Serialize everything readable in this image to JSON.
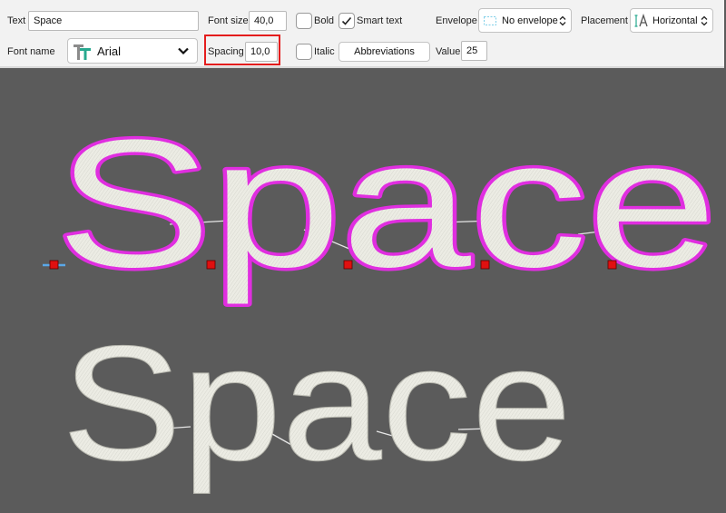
{
  "toolbar": {
    "text_label": "Text",
    "text_value": "Space",
    "font_name_label": "Font name",
    "font_name_value": "Arial",
    "font_size_label": "Font size",
    "font_size_value": "40,0",
    "spacing_label": "Spacing",
    "spacing_value": "10,0",
    "bold_label": "Bold",
    "italic_label": "Italic",
    "smart_text_label": "Smart text",
    "abbreviations_label": "Abbreviations",
    "envelope_label": "Envelope",
    "envelope_value": "No envelope",
    "value_label": "Value",
    "value_value": "25",
    "placement_label": "Placement",
    "placement_value": "Horizontal",
    "bold_checked": false,
    "italic_checked": false,
    "smart_text_checked": true
  },
  "canvas": {
    "selected_text": "Space",
    "preview_text": "Space",
    "colors": {
      "background": "#5b5b5b",
      "selection_outline": "#e02ee0",
      "stitch_fill": "#ecece4",
      "connector": "#e6e6e6",
      "anchor": "#e01010",
      "highlight": "#e41d1d"
    }
  }
}
